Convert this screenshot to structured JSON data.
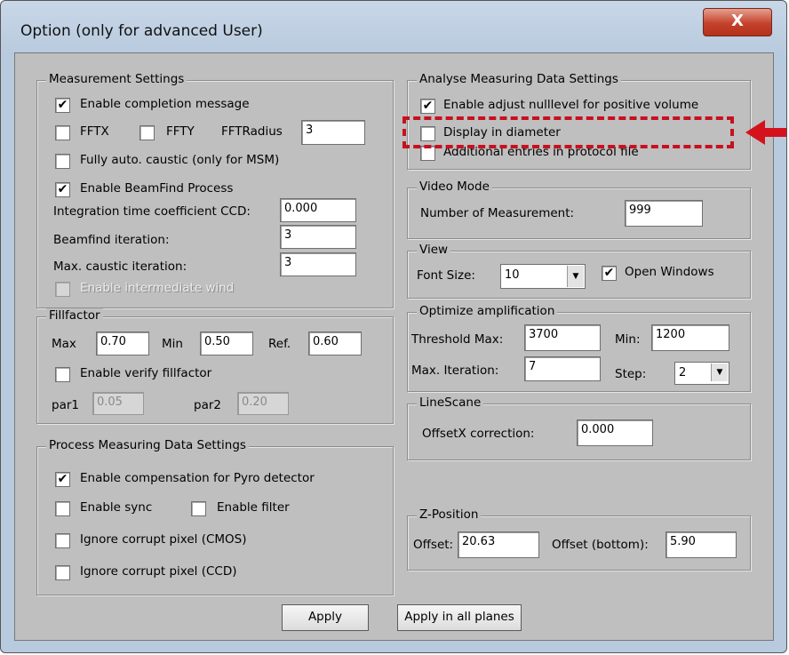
{
  "window": {
    "title": "Option (only for advanced User)",
    "close_glyph": "X"
  },
  "measurement": {
    "legend": "Measurement Settings",
    "enable_completion": {
      "label": "Enable completion message",
      "checked": true
    },
    "fftx": {
      "label": "FFTX",
      "checked": false
    },
    "ffty": {
      "label": "FFTY",
      "checked": false
    },
    "fftradius": {
      "label": "FFTRadius",
      "value": "3"
    },
    "fully_auto": {
      "label": "Fully auto. caustic (only for MSM)",
      "checked": false
    },
    "beamfind": {
      "label": "Enable BeamFind Process",
      "checked": true
    },
    "integration": {
      "label": "Integration time coefficient CCD:",
      "value": "0.000"
    },
    "beamfind_iter": {
      "label": "Beamfind iteration:",
      "value": "3"
    },
    "max_caustic": {
      "label": "Max. caustic iteration:",
      "value": "3"
    },
    "intermediate": {
      "label": "Enable intermediate wind",
      "checked": false
    }
  },
  "fillfactor": {
    "legend": "Fillfactor",
    "max_label": "Max",
    "max_value": "0.70",
    "min_label": "Min",
    "min_value": "0.50",
    "ref_label": "Ref.",
    "ref_value": "0.60",
    "verify": {
      "label": "Enable verify fillfactor",
      "checked": false
    },
    "par1_label": "par1",
    "par1_value": "0.05",
    "par2_label": "par2",
    "par2_value": "0.20"
  },
  "process": {
    "legend": "Process Measuring Data Settings",
    "pyro": {
      "label": "Enable compensation for Pyro detector",
      "checked": true
    },
    "sync": {
      "label": "Enable sync",
      "checked": false
    },
    "filter": {
      "label": "Enable filter",
      "checked": false
    },
    "cmos": {
      "label": "Ignore corrupt pixel (CMOS)",
      "checked": false
    },
    "ccd": {
      "label": "Ignore corrupt pixel (CCD)",
      "checked": false
    }
  },
  "analyse": {
    "legend": "Analyse Measuring Data Settings",
    "nulllevel": {
      "label": "Enable adjust nulllevel for positive volume",
      "checked": true
    },
    "diameter": {
      "label": "Display in diameter",
      "checked": false
    },
    "protocol": {
      "label": "Additional entries in protocol file",
      "checked": false
    }
  },
  "video": {
    "legend": "Video Mode",
    "label": "Number of Measurement:",
    "value": "999"
  },
  "view": {
    "legend": "View",
    "font_label": "Font Size:",
    "font_value": "10",
    "open_windows": {
      "label": "Open Windows",
      "checked": true
    }
  },
  "optimize": {
    "legend": "Optimize amplification",
    "thr_max_label": "Threshold Max:",
    "thr_max_value": "3700",
    "min_label": "Min:",
    "min_value": "1200",
    "max_iter_label": "Max. Iteration:",
    "max_iter_value": "7",
    "step_label": "Step:",
    "step_value": "2"
  },
  "linescan": {
    "legend": "LineScane",
    "label": "OffsetX correction:",
    "value": "0.000"
  },
  "zpos": {
    "legend": "Z-Position",
    "offset_label": "Offset:",
    "offset_value": "20.63",
    "bottom_label": "Offset (bottom):",
    "bottom_value": "5.90"
  },
  "buttons": {
    "apply": "Apply",
    "apply_all": "Apply in  all planes"
  },
  "glyphs": {
    "check": "✔",
    "dropdown": "▼"
  },
  "colors": {
    "highlight": "#c8101e",
    "client_bg": "#bfbfbf"
  }
}
